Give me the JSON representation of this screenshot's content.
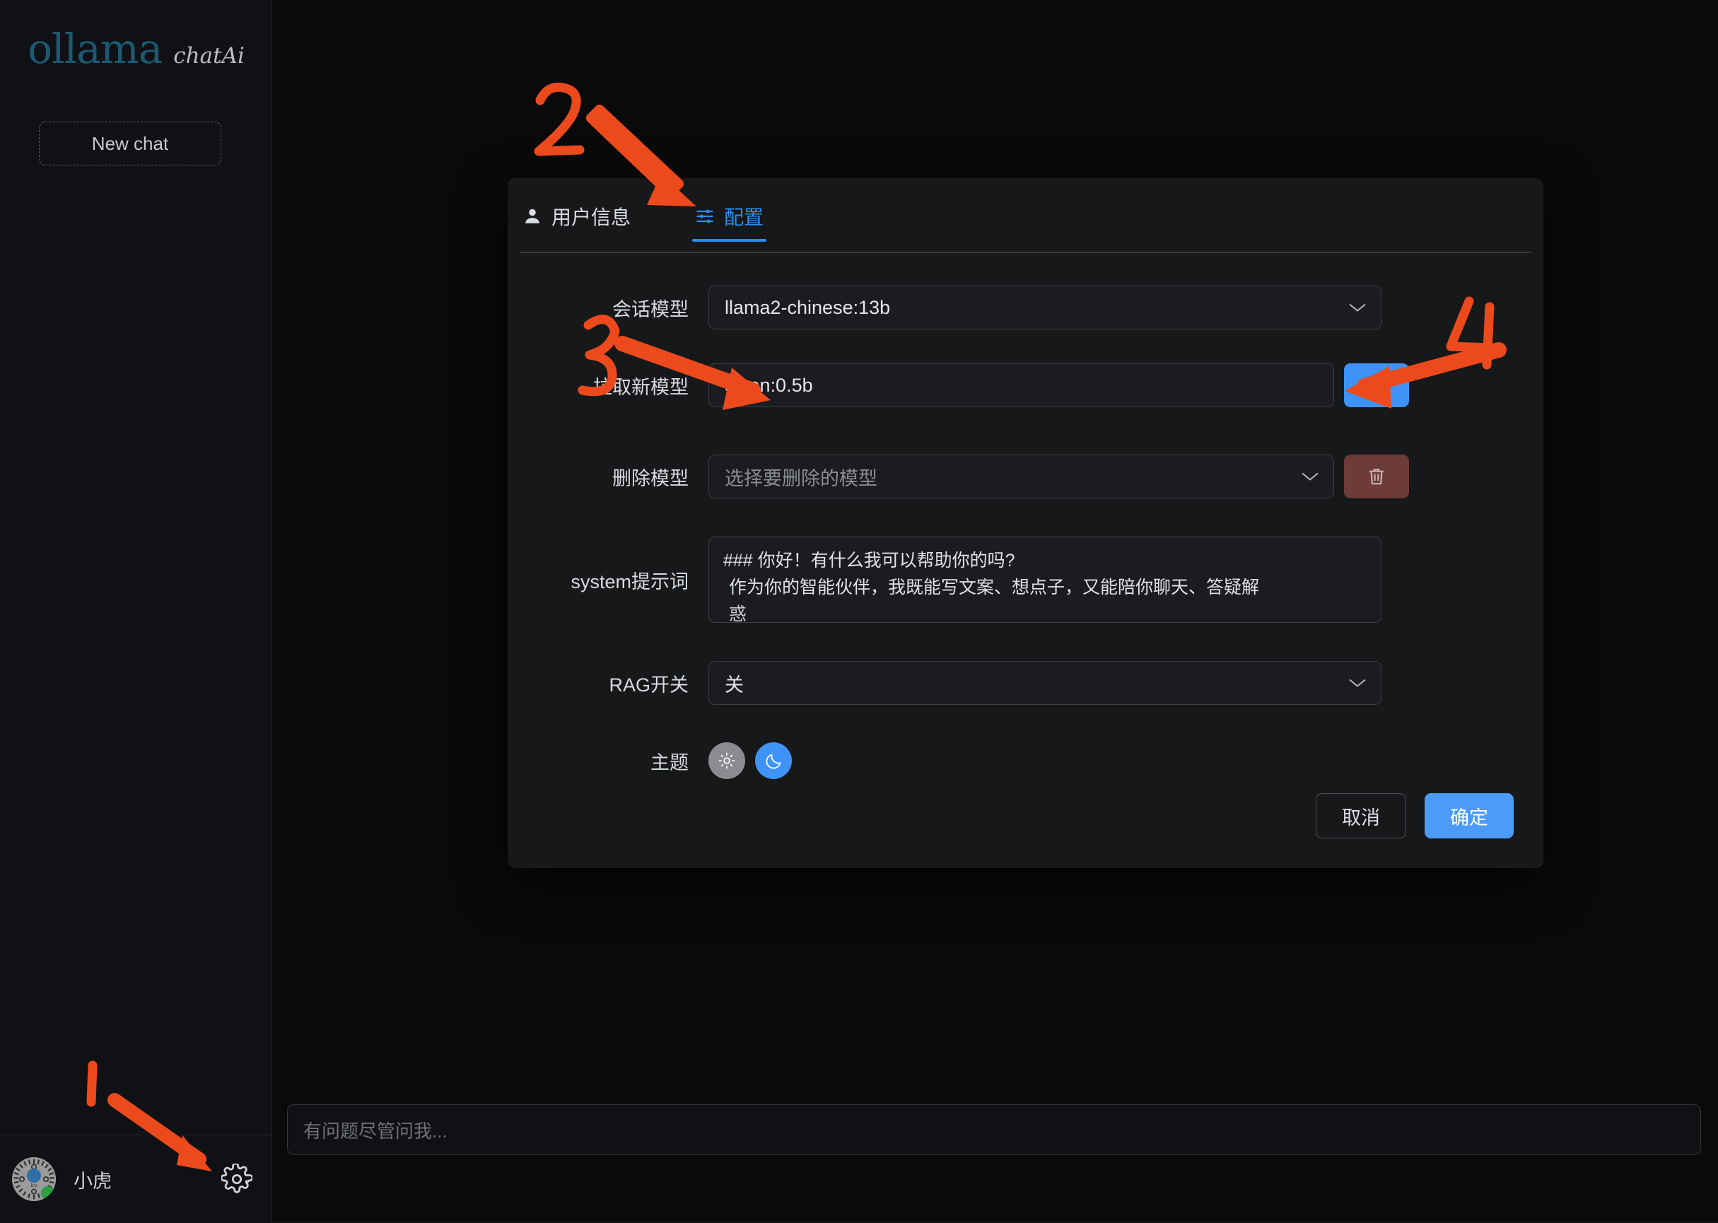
{
  "app": {
    "brand_primary": "ollama",
    "brand_secondary": "chatAi",
    "accent_color": "#3f93f7",
    "annotation_color": "#ec4a1c"
  },
  "sidebar": {
    "new_chat_label": "New chat",
    "user": {
      "name": "小虎",
      "avatar_icon": "qr-code-avatar",
      "badge_icon": "wechat-badge-icon",
      "settings_icon": "gear-icon"
    }
  },
  "composer": {
    "placeholder": "有问题尽管问我...",
    "value": ""
  },
  "dialog": {
    "tabs": [
      {
        "label": "用户信息",
        "icon": "person-icon",
        "active": false
      },
      {
        "label": "配置",
        "icon": "sliders-icon",
        "active": true
      }
    ],
    "fields": {
      "chat_model": {
        "label": "会话模型",
        "value": "llama2-chinese:13b",
        "control": "select",
        "icon": "chevron-down-icon"
      },
      "pull_model": {
        "label": "拉取新模型",
        "value": "qwen:0.5b",
        "placeholder": "",
        "control": "input",
        "action_icon": "plus-circle-icon"
      },
      "delete_model": {
        "label": "删除模型",
        "value": "",
        "placeholder": "选择要删除的模型",
        "control": "select",
        "icon": "chevron-down-icon",
        "action_icon": "trash-icon"
      },
      "system_prompt": {
        "label": "system提示词",
        "line1": "### 你好！有什么我可以帮助你的吗?",
        "line2": "作为你的智能伙伴，我既能写文案、想点子，又能陪你聊天、答疑解",
        "line3": "惑"
      },
      "rag_switch": {
        "label": "RAG开关",
        "value": "关",
        "control": "select",
        "icon": "chevron-down-icon"
      },
      "theme": {
        "label": "主题",
        "options": [
          {
            "name": "light",
            "icon": "sun-icon",
            "selected": false
          },
          {
            "name": "dark",
            "icon": "moon-icon",
            "selected": true
          }
        ]
      }
    },
    "footer": {
      "cancel_label": "取消",
      "confirm_label": "确定"
    }
  },
  "annotations": [
    {
      "id": "1",
      "label": "1",
      "target": "settings-gear"
    },
    {
      "id": "2",
      "label": "2",
      "target": "config-tab"
    },
    {
      "id": "3",
      "label": "3",
      "target": "pull-model-input"
    },
    {
      "id": "4",
      "label": "4",
      "target": "pull-model-add-button"
    }
  ]
}
